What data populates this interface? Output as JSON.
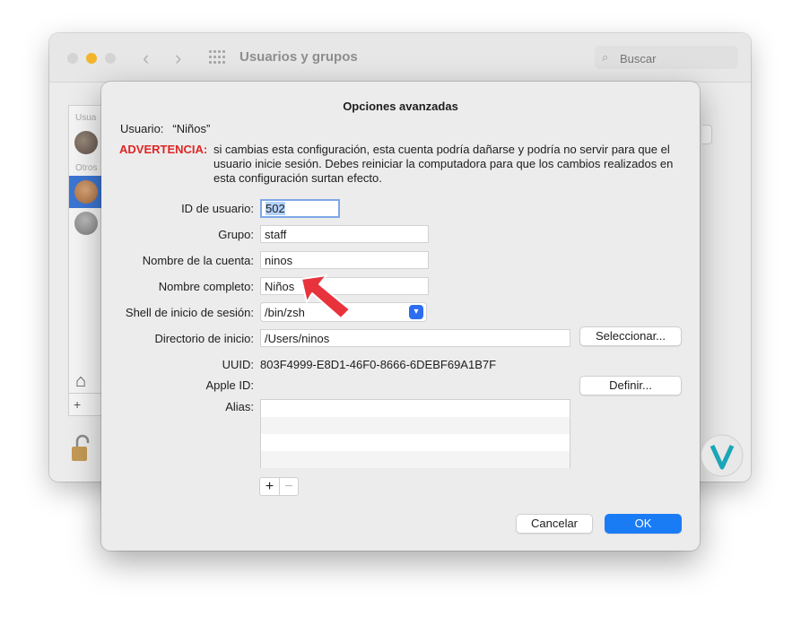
{
  "window": {
    "title": "Usuarios y grupos",
    "search_placeholder": "Buscar"
  },
  "sidebar": {
    "section_users": "Usua",
    "section_others": "Otros"
  },
  "sheet": {
    "title": "Opciones avanzadas",
    "user_label": "Usuario:",
    "user_name": "“Niños”",
    "warning_label": "ADVERTENCIA:",
    "warning_text": "si cambias esta configuración, esta cuenta podría dañarse y podría no servir para que el usuario inicie sesión. Debes reiniciar la computadora para que los cambios realizados en esta configuración surtan efecto.",
    "fields": {
      "user_id_label": "ID de usuario:",
      "user_id_value": "502",
      "group_label": "Grupo:",
      "group_value": "staff",
      "account_name_label": "Nombre de la cuenta:",
      "account_name_value": "ninos",
      "full_name_label": "Nombre completo:",
      "full_name_value": "Niños",
      "shell_label": "Shell de inicio de sesión:",
      "shell_value": "/bin/zsh",
      "home_dir_label": "Directorio de inicio:",
      "home_dir_value": "/Users/ninos",
      "select_button": "Seleccionar...",
      "uuid_label": "UUID:",
      "uuid_value": "803F4999-E8D1-46F0-8666-6DEBF69A1B7F",
      "apple_id_label": "Apple ID:",
      "define_button": "Definir...",
      "alias_label": "Alias:"
    },
    "alias_add": "+",
    "alias_remove": "−",
    "cancel_button": "Cancelar",
    "ok_button": "OK"
  },
  "colors": {
    "warning": "#e02626",
    "primary_button": "#1a7cf5",
    "annotation_arrow": "#e8333d"
  },
  "icons": [
    "search-icon",
    "house-icon",
    "lock-icon",
    "chevron-updown-icon",
    "back-chevron-icon",
    "forward-chevron-icon",
    "grid-icon"
  ]
}
